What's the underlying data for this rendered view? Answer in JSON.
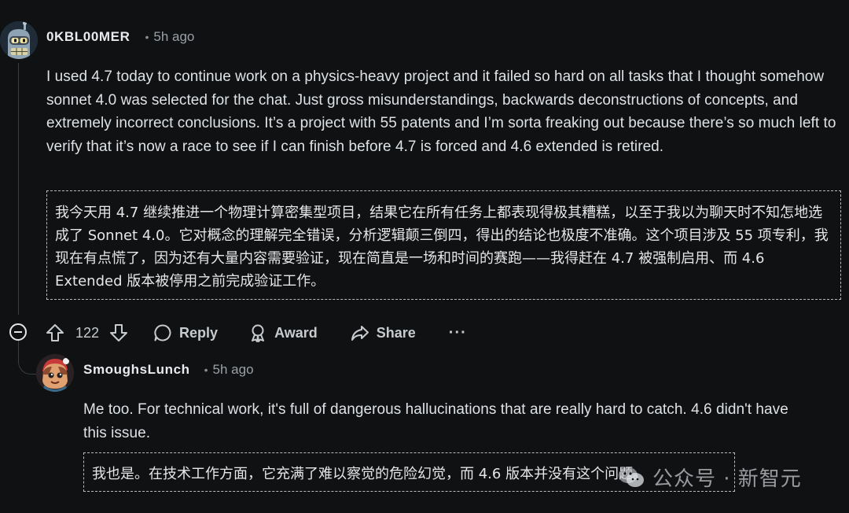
{
  "comment": {
    "author": "0KBL00MER",
    "separator": "•",
    "time": "5h ago",
    "body": "I used 4.7 today to continue work on a physics-heavy project and it failed so hard on all tasks that I thought somehow sonnet 4.0 was selected for the chat. Just gross misunderstandings, backwards deconstructions of concepts, and extremely incorrect conclusions. It’s a project with 55 patents and I’m sorta freaking out because there’s so much left to verify that it’s now a race to see if I can finish before 4.7 is forced and 4.6 extended is retired.",
    "translation": "我今天用 4.7 继续推进一个物理计算密集型项目，结果它在所有任务上都表现得极其糟糕，以至于我以为聊天时不知怎地选成了 Sonnet 4.0。它对概念的理解完全错误，分析逻辑颠三倒四，得出的结论也极度不准确。这个项目涉及 55 项专利，我现在有点慌了，因为还有大量内容需要验证，现在简直是一场和时间的赛跑——我得赶在 4.7 被强制启用、而 4.6 Extended 版本被停用之前完成验证工作。",
    "actions": {
      "vote_count": "122",
      "reply": "Reply",
      "award": "Award",
      "share": "Share",
      "more": "···"
    }
  },
  "reply": {
    "author": "SmoughsLunch",
    "separator": "•",
    "time": "5h ago",
    "body": "Me too. For technical work, it's full of dangerous hallucinations that are really hard to catch. 4.6 didn't have this issue.",
    "translation": "我也是。在技术工作方面，它充满了难以察觉的危险幻觉，而 4.6 版本并没有这个问题。"
  },
  "watermark": {
    "text": "公众号 · 新智元"
  },
  "colors": {
    "background": "#0f1113",
    "text": "#dfe2e5",
    "muted": "#9aa0a6",
    "thread_line": "#3a3d40"
  }
}
